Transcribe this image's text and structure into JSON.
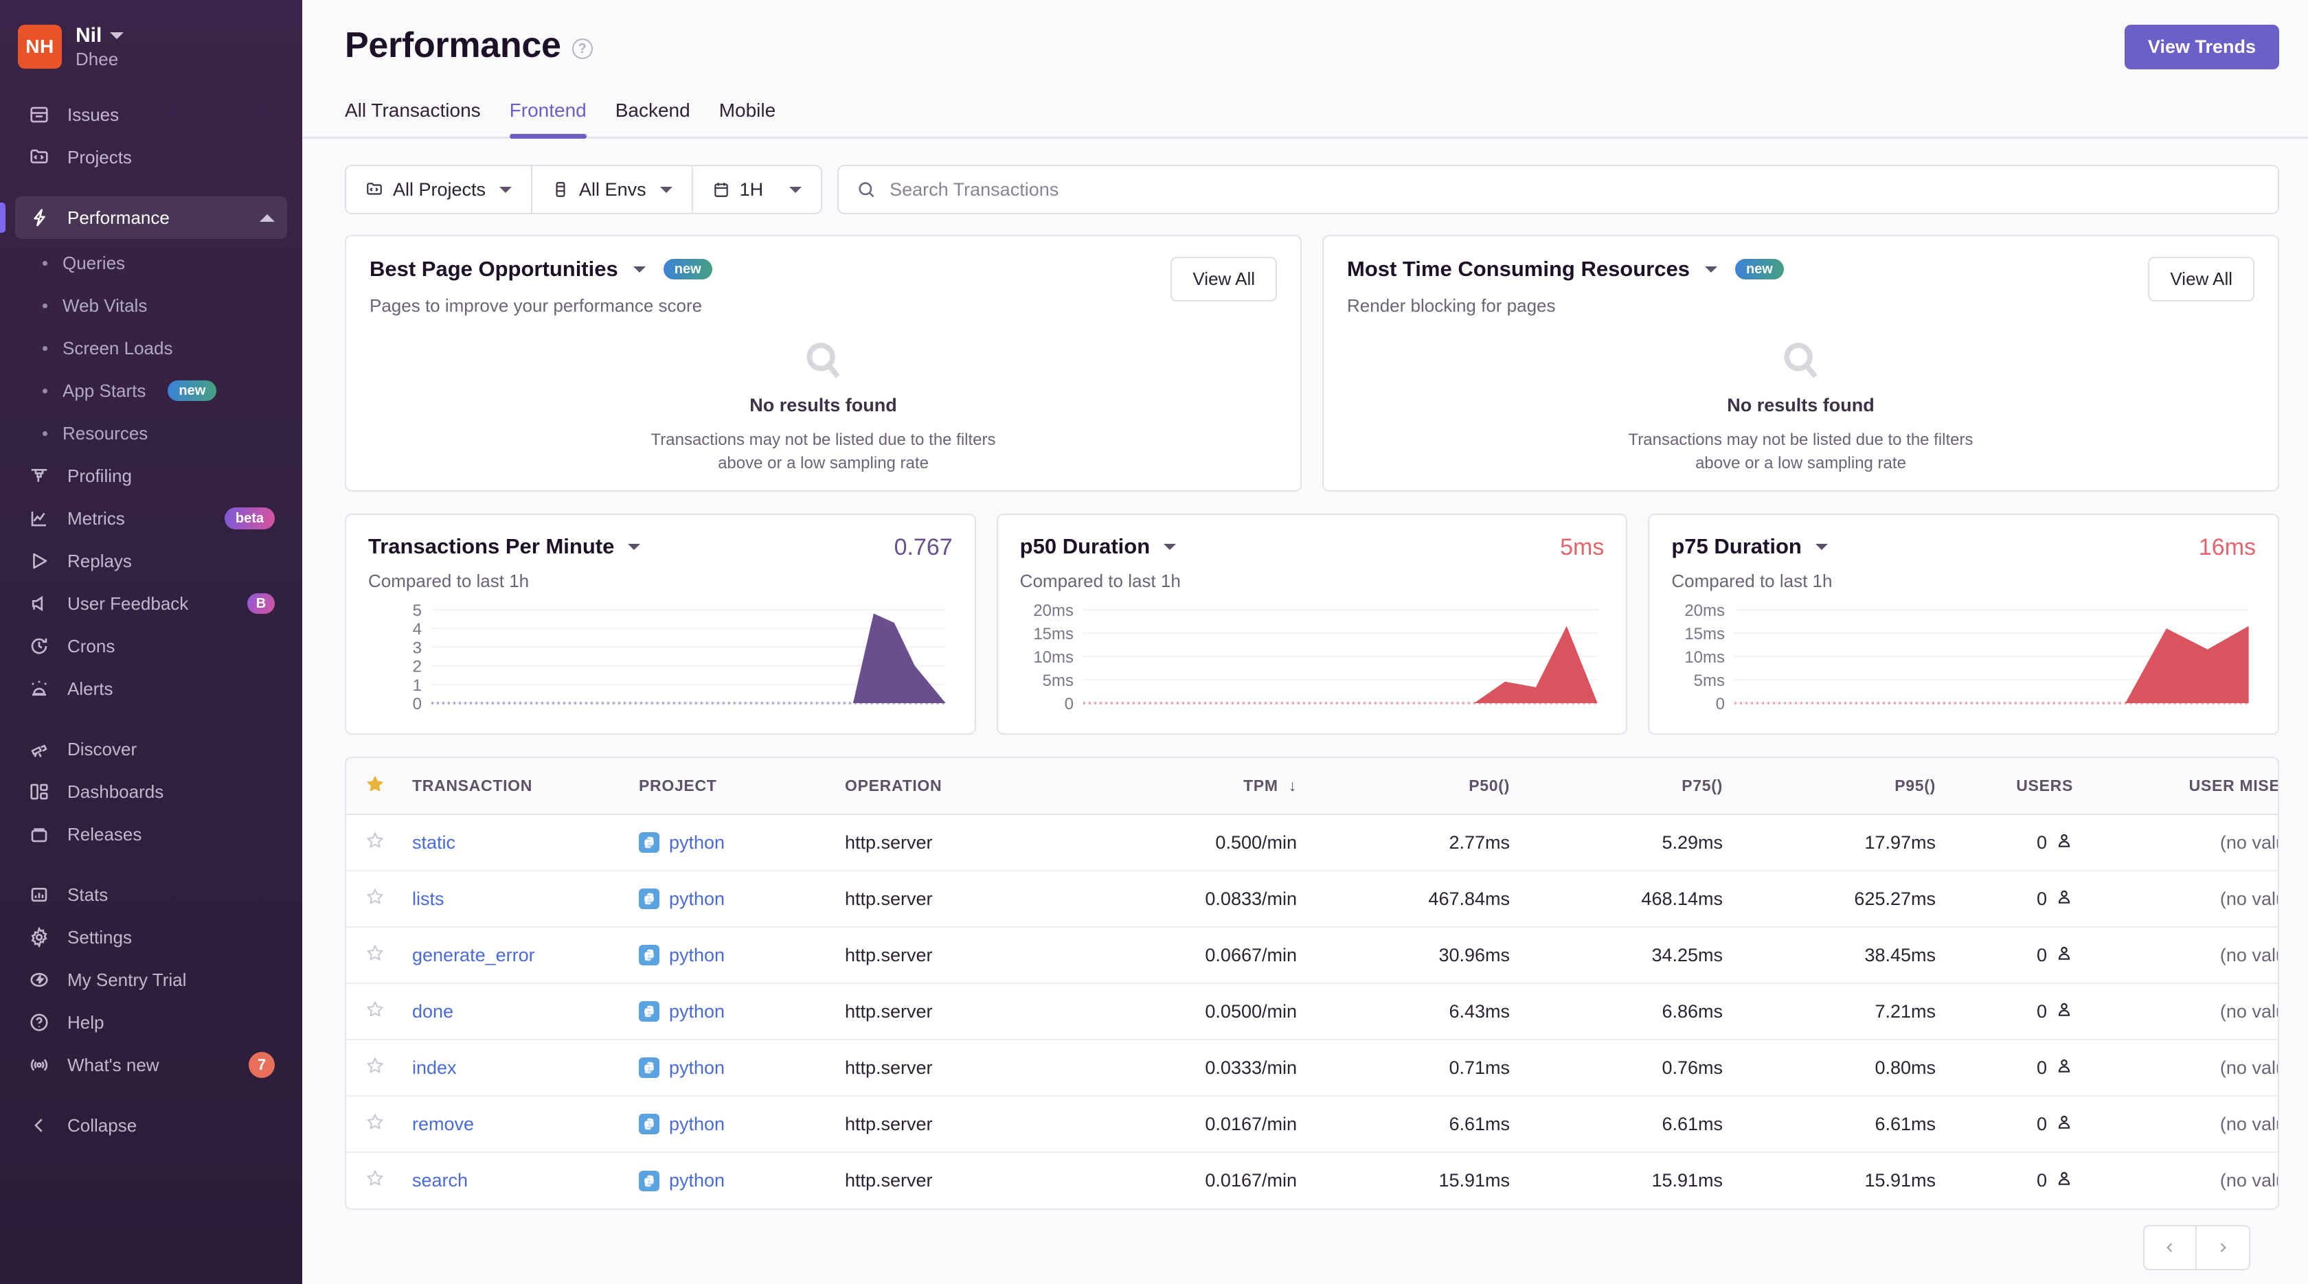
{
  "sidebar": {
    "org": {
      "initials": "NH",
      "name": "Nil",
      "subtitle": "Dhee"
    },
    "primary_items": [
      {
        "label": "Issues",
        "icon": "issues-icon"
      },
      {
        "label": "Projects",
        "icon": "projects-icon"
      }
    ],
    "performance": {
      "label": "Performance",
      "icon": "lightning-icon",
      "expanded": true
    },
    "performance_children": [
      {
        "label": "Queries",
        "badge": ""
      },
      {
        "label": "Web Vitals",
        "badge": ""
      },
      {
        "label": "Screen Loads",
        "badge": ""
      },
      {
        "label": "App Starts",
        "badge": "new"
      },
      {
        "label": "Resources",
        "badge": ""
      }
    ],
    "tools_items": [
      {
        "label": "Profiling",
        "icon": "profiling-icon",
        "badge": ""
      },
      {
        "label": "Metrics",
        "icon": "metrics-icon",
        "badge": "beta"
      },
      {
        "label": "Replays",
        "icon": "replays-icon",
        "badge": ""
      },
      {
        "label": "User Feedback",
        "icon": "megaphone-icon",
        "badge": "B"
      },
      {
        "label": "Crons",
        "icon": "crons-icon",
        "badge": ""
      },
      {
        "label": "Alerts",
        "icon": "alerts-icon",
        "badge": ""
      }
    ],
    "explore_items": [
      {
        "label": "Discover",
        "icon": "telescope-icon"
      },
      {
        "label": "Dashboards",
        "icon": "dashboards-icon"
      },
      {
        "label": "Releases",
        "icon": "releases-icon"
      }
    ],
    "admin_items": [
      {
        "label": "Stats",
        "icon": "stats-icon"
      },
      {
        "label": "Settings",
        "icon": "gear-icon"
      }
    ],
    "footer_items": [
      {
        "label": "My Sentry Trial",
        "icon": "trial-icon",
        "badge": ""
      },
      {
        "label": "Help",
        "icon": "help-icon",
        "badge": ""
      },
      {
        "label": "What's new",
        "icon": "broadcast-icon",
        "badge": "7"
      }
    ],
    "collapse": {
      "label": "Collapse",
      "icon": "chevron-left-icon"
    }
  },
  "header": {
    "title": "Performance",
    "help_glyph": "?",
    "view_trends_label": "View Trends",
    "tabs": [
      {
        "label": "All Transactions",
        "active": false
      },
      {
        "label": "Frontend",
        "active": true
      },
      {
        "label": "Backend",
        "active": false
      },
      {
        "label": "Mobile",
        "active": false
      }
    ]
  },
  "filters": {
    "projects_label": "All Projects",
    "envs_label": "All Envs",
    "time_label": "1H",
    "search_placeholder": "Search Transactions",
    "search_value": ""
  },
  "opportunity_cards": [
    {
      "title": "Best Page Opportunities",
      "badge": "new",
      "subtitle": "Pages to improve your performance score",
      "action_label": "View All",
      "empty_title": "No results found",
      "empty_line1": "Transactions may not be listed due to the filters",
      "empty_line2": "above or a low sampling rate"
    },
    {
      "title": "Most Time Consuming Resources",
      "badge": "new",
      "subtitle": "Render blocking for pages",
      "action_label": "View All",
      "empty_title": "No results found",
      "empty_line1": "Transactions may not be listed due to the filters",
      "empty_line2": "above or a low sampling rate"
    }
  ],
  "chart_data": [
    {
      "type": "area",
      "title": "Transactions Per Minute",
      "subtitle": "Compared to last 1h",
      "value_label": "0.767",
      "color": "#6a4f8f",
      "ylabel": "",
      "xlabel": "",
      "ylim": [
        0,
        5
      ],
      "tick_labels": [
        "5",
        "4",
        "3",
        "2",
        "1",
        "0"
      ],
      "ticks": [
        5,
        4,
        3,
        2,
        1,
        0
      ],
      "x": [
        0,
        10,
        20,
        30,
        40,
        50,
        60,
        70,
        74,
        78,
        82,
        86,
        90,
        94,
        100
      ],
      "values": [
        0,
        0,
        0,
        0,
        0,
        0,
        0,
        0,
        0,
        0,
        0,
        4.8,
        4.3,
        2.0,
        0
      ]
    },
    {
      "type": "area",
      "title": "p50 Duration",
      "subtitle": "Compared to last 1h",
      "value_label": "5ms",
      "color": "#d9545e",
      "ylabel": "",
      "xlabel": "",
      "ylim": [
        0,
        20
      ],
      "tick_labels": [
        "20ms",
        "15ms",
        "10ms",
        "5ms",
        "0"
      ],
      "ticks": [
        20,
        15,
        10,
        5,
        0
      ],
      "x": [
        0,
        10,
        20,
        30,
        40,
        50,
        60,
        70,
        76,
        82,
        88,
        94,
        100
      ],
      "values": [
        0,
        0,
        0,
        0,
        0,
        0,
        0,
        0,
        0,
        4.6,
        3.4,
        16.5,
        0
      ]
    },
    {
      "type": "area",
      "title": "p75 Duration",
      "subtitle": "Compared to last 1h",
      "value_label": "16ms",
      "color": "#d9545e",
      "ylabel": "",
      "xlabel": "",
      "ylim": [
        0,
        20
      ],
      "tick_labels": [
        "20ms",
        "15ms",
        "10ms",
        "5ms",
        "0"
      ],
      "ticks": [
        20,
        15,
        10,
        5,
        0
      ],
      "x": [
        0,
        10,
        20,
        30,
        40,
        50,
        60,
        70,
        76,
        84,
        92,
        100
      ],
      "values": [
        0,
        0,
        0,
        0,
        0,
        0,
        0,
        0,
        0,
        16.0,
        11.5,
        16.5
      ]
    }
  ],
  "table": {
    "columns": [
      {
        "key": "star",
        "label": ""
      },
      {
        "key": "transaction",
        "label": "TRANSACTION"
      },
      {
        "key": "project",
        "label": "PROJECT"
      },
      {
        "key": "operation",
        "label": "OPERATION"
      },
      {
        "key": "tpm",
        "label": "TPM",
        "sorted": "desc"
      },
      {
        "key": "p50",
        "label": "P50()"
      },
      {
        "key": "p75",
        "label": "P75()"
      },
      {
        "key": "p95",
        "label": "P95()"
      },
      {
        "key": "users",
        "label": "USERS"
      },
      {
        "key": "misery",
        "label": "USER MISERY"
      }
    ],
    "rows": [
      {
        "transaction": "static",
        "project": "python",
        "operation": "http.server",
        "tpm": "0.500/min",
        "p50": "2.77ms",
        "p75": "5.29ms",
        "p95": "17.97ms",
        "users": "0",
        "misery": "(no value)"
      },
      {
        "transaction": "lists",
        "project": "python",
        "operation": "http.server",
        "tpm": "0.0833/min",
        "p50": "467.84ms",
        "p75": "468.14ms",
        "p95": "625.27ms",
        "users": "0",
        "misery": "(no value)"
      },
      {
        "transaction": "generate_error",
        "project": "python",
        "operation": "http.server",
        "tpm": "0.0667/min",
        "p50": "30.96ms",
        "p75": "34.25ms",
        "p95": "38.45ms",
        "users": "0",
        "misery": "(no value)"
      },
      {
        "transaction": "done",
        "project": "python",
        "operation": "http.server",
        "tpm": "0.0500/min",
        "p50": "6.43ms",
        "p75": "6.86ms",
        "p95": "7.21ms",
        "users": "0",
        "misery": "(no value)"
      },
      {
        "transaction": "index",
        "project": "python",
        "operation": "http.server",
        "tpm": "0.0333/min",
        "p50": "0.71ms",
        "p75": "0.76ms",
        "p95": "0.80ms",
        "users": "0",
        "misery": "(no value)"
      },
      {
        "transaction": "remove",
        "project": "python",
        "operation": "http.server",
        "tpm": "0.0167/min",
        "p50": "6.61ms",
        "p75": "6.61ms",
        "p95": "6.61ms",
        "users": "0",
        "misery": "(no value)"
      },
      {
        "transaction": "search",
        "project": "python",
        "operation": "http.server",
        "tpm": "0.0167/min",
        "p50": "15.91ms",
        "p75": "15.91ms",
        "p95": "15.91ms",
        "users": "0",
        "misery": "(no value)"
      }
    ]
  },
  "colors": {
    "accent": "#6c5fc7",
    "sidebar_bg": "#31203f",
    "avatar": "#e8532a",
    "link": "#4a6bd6",
    "tpm_area": "#6a4f8f",
    "duration_area": "#d9545e",
    "badge_count": "#e8705a"
  }
}
